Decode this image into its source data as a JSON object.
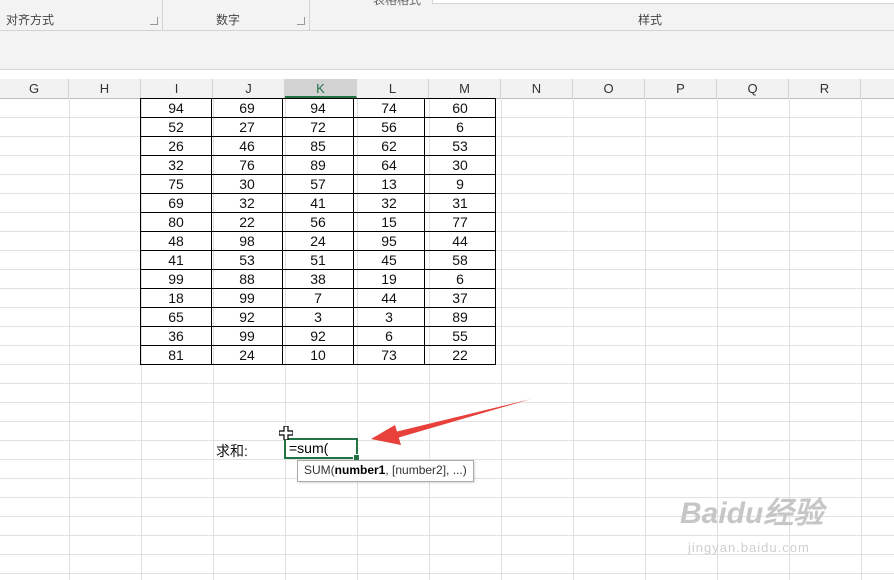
{
  "ribbon": {
    "groups": [
      "对齐方式",
      "数字",
      "样式"
    ],
    "cut_text": "表格格式"
  },
  "columns": [
    "G",
    "H",
    "I",
    "J",
    "K",
    "L",
    "M",
    "N",
    "O",
    "P",
    "Q",
    "R"
  ],
  "active_column": "K",
  "table": {
    "rows": [
      [
        "94",
        "69",
        "94",
        "74",
        "60"
      ],
      [
        "52",
        "27",
        "72",
        "56",
        "6"
      ],
      [
        "26",
        "46",
        "85",
        "62",
        "53"
      ],
      [
        "32",
        "76",
        "89",
        "64",
        "30"
      ],
      [
        "75",
        "30",
        "57",
        "13",
        "9"
      ],
      [
        "69",
        "32",
        "41",
        "32",
        "31"
      ],
      [
        "80",
        "22",
        "56",
        "15",
        "77"
      ],
      [
        "48",
        "98",
        "24",
        "95",
        "44"
      ],
      [
        "41",
        "53",
        "51",
        "45",
        "58"
      ],
      [
        "99",
        "88",
        "38",
        "19",
        "6"
      ],
      [
        "18",
        "99",
        "7",
        "44",
        "37"
      ],
      [
        "65",
        "92",
        "3",
        "3",
        "89"
      ],
      [
        "36",
        "99",
        "92",
        "6",
        "55"
      ],
      [
        "81",
        "24",
        "10",
        "73",
        "22"
      ]
    ]
  },
  "sum_label": "求和:",
  "edit_cell": {
    "value": "=sum("
  },
  "tooltip": {
    "func": "SUM(",
    "arg1": "number1",
    "rest": ", [number2], ...)"
  },
  "watermark": {
    "logo": "Baidu经验",
    "url": "jingyan.baidu.com"
  },
  "colors": {
    "accent": "#217346",
    "arrow": "#e8403a"
  }
}
